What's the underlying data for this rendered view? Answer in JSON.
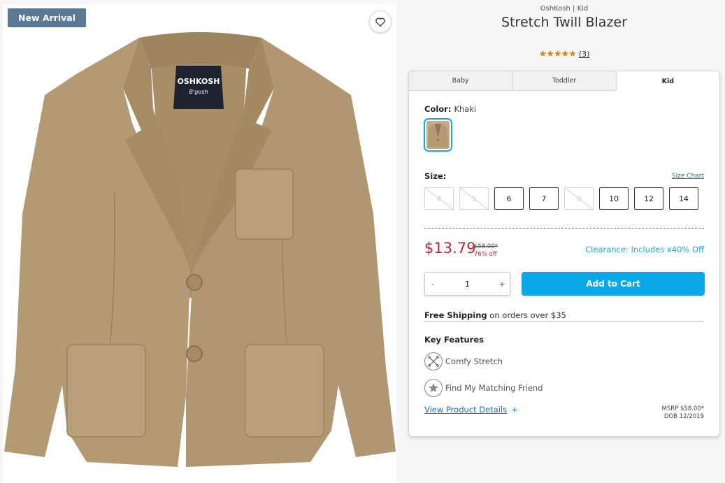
{
  "badge": "New Arrival",
  "product": {
    "brand_line": "OshKosh | Kid",
    "title": "Stretch Twill Blazer",
    "stars": "★★★★★",
    "rating": 5,
    "review_count": "(3)"
  },
  "tabs": [
    {
      "label": "Baby",
      "active": false
    },
    {
      "label": "Toddler",
      "active": false
    },
    {
      "label": "Kid",
      "active": true
    }
  ],
  "color": {
    "label": "Color:",
    "value": "Khaki"
  },
  "size": {
    "label": "Size:",
    "chart_link": "Size Chart",
    "options": [
      {
        "label": "4",
        "available": false
      },
      {
        "label": "5",
        "available": false
      },
      {
        "label": "6",
        "available": true
      },
      {
        "label": "7",
        "available": true
      },
      {
        "label": "8",
        "available": false
      },
      {
        "label": "10",
        "available": true
      },
      {
        "label": "12",
        "available": true
      },
      {
        "label": "14",
        "available": true
      }
    ]
  },
  "pricing": {
    "sale_price": "$13.79",
    "original_price": "$58.00*",
    "percent_off": "76% off",
    "clearance": "Clearance: Includes x40% Off"
  },
  "cart": {
    "minus": "-",
    "quantity": "1",
    "plus": "+",
    "add_label": "Add to Cart"
  },
  "shipping": {
    "bold": "Free Shipping",
    "rest": "on orders over $35"
  },
  "features": {
    "title": "Key Features",
    "items": [
      {
        "label": "Comfy Stretch",
        "icon": "stretch-icon"
      },
      {
        "label": "Find My Matching Friend",
        "icon": "star-badge-icon"
      }
    ]
  },
  "details": {
    "link": "View Product Details",
    "plus": "+",
    "msrp": "MSRP $58.00*",
    "dob": "DOB 12/2019"
  },
  "colors": {
    "accent": "#0aa8e6",
    "sale": "#d0202f",
    "badge": "#5b7894",
    "stars": "#e0830c",
    "jacket": "#b39a73"
  }
}
